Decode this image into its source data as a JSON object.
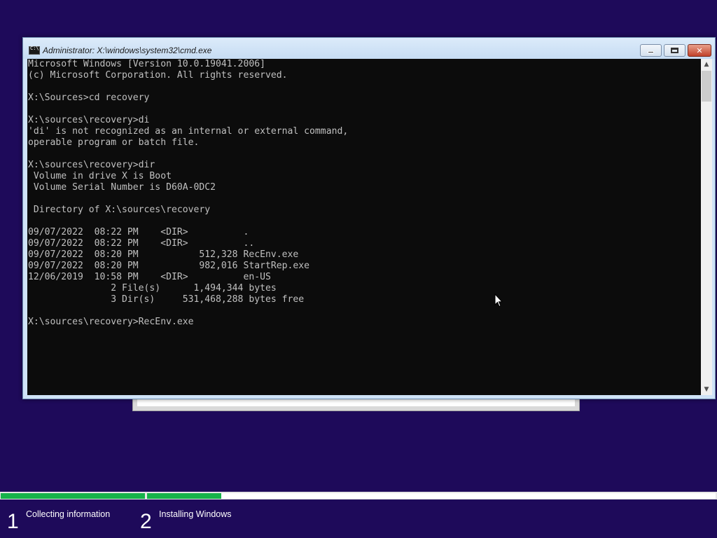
{
  "window": {
    "title": "Administrator: X:\\windows\\system32\\cmd.exe",
    "minimize_label": "–",
    "close_label": "✕"
  },
  "console": {
    "lines": [
      "Microsoft Windows [Version 10.0.19041.2006]",
      "(c) Microsoft Corporation. All rights reserved.",
      "",
      "X:\\Sources>cd recovery",
      "",
      "X:\\sources\\recovery>di",
      "'di' is not recognized as an internal or external command,",
      "operable program or batch file.",
      "",
      "X:\\sources\\recovery>dir",
      " Volume in drive X is Boot",
      " Volume Serial Number is D60A-0DC2",
      "",
      " Directory of X:\\sources\\recovery",
      "",
      "09/07/2022  08:22 PM    <DIR>          .",
      "09/07/2022  08:22 PM    <DIR>          ..",
      "09/07/2022  08:20 PM           512,328 RecEnv.exe",
      "09/07/2022  08:20 PM           982,016 StartRep.exe",
      "12/06/2019  10:58 PM    <DIR>          en-US",
      "               2 File(s)      1,494,344 bytes",
      "               3 Dir(s)     531,468,288 bytes free",
      "",
      "X:\\sources\\recovery>RecEnv.exe"
    ]
  },
  "setup_progress": {
    "step1_fraction": 1.0,
    "step2_fraction": 0.13,
    "accent_color": "#16b24a"
  },
  "steps": [
    {
      "number": "1",
      "label": "Collecting information"
    },
    {
      "number": "2",
      "label": "Installing Windows"
    }
  ],
  "colors": {
    "desktop_bg": "#1e0a5a",
    "console_bg": "#0c0c0c",
    "console_fg": "#c0c0c0"
  }
}
